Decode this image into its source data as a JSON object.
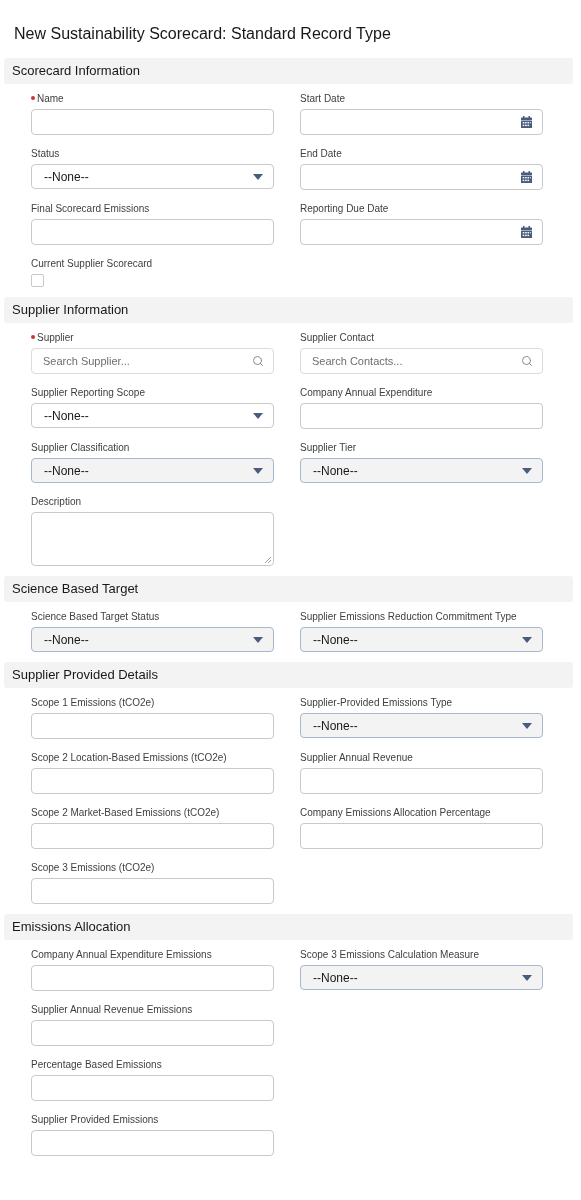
{
  "title": "New Sustainability Scorecard: Standard Record Type",
  "sections": [
    {
      "title": "Scorecard Information",
      "rows": [
        {
          "left": {
            "kind": "text",
            "label": "Name",
            "required": true
          },
          "right": {
            "kind": "date",
            "label": "Start Date",
            "required": false
          }
        },
        {
          "left": {
            "kind": "select",
            "label": "Status",
            "required": false,
            "value": "--None--",
            "shaded": false
          },
          "right": {
            "kind": "date",
            "label": "End Date",
            "required": false
          }
        },
        {
          "left": {
            "kind": "text",
            "label": "Final Scorecard Emissions",
            "required": false
          },
          "right": {
            "kind": "date",
            "label": "Reporting Due Date",
            "required": false
          }
        },
        {
          "left": {
            "kind": "checkbox",
            "label": "Current Supplier Scorecard",
            "required": false,
            "checked": false
          }
        }
      ]
    },
    {
      "title": "Supplier Information",
      "rows": [
        {
          "left": {
            "kind": "lookup",
            "label": "Supplier",
            "required": true,
            "placeholder": "Search Supplier..."
          },
          "right": {
            "kind": "lookup",
            "label": "Supplier Contact",
            "required": false,
            "placeholder": "Search Contacts..."
          }
        },
        {
          "left": {
            "kind": "select",
            "label": "Supplier Reporting Scope",
            "required": false,
            "value": "--None--",
            "shaded": false
          },
          "right": {
            "kind": "text",
            "label": "Company Annual Expenditure",
            "required": false
          }
        },
        {
          "left": {
            "kind": "select",
            "label": "Supplier Classification",
            "required": false,
            "value": "--None--",
            "shaded": true
          },
          "right": {
            "kind": "select",
            "label": "Supplier Tier",
            "required": false,
            "value": "--None--",
            "shaded": true
          }
        },
        {
          "left": {
            "kind": "textarea",
            "label": "Description",
            "required": false
          }
        }
      ]
    },
    {
      "title": "Science Based Target",
      "rows": [
        {
          "left": {
            "kind": "select",
            "label": "Science Based Target Status",
            "required": false,
            "value": "--None--",
            "shaded": true
          },
          "right": {
            "kind": "select",
            "label": "Supplier Emissions Reduction Commitment Type",
            "required": false,
            "value": "--None--",
            "shaded": true
          }
        }
      ]
    },
    {
      "title": "Supplier Provided Details",
      "rows": [
        {
          "left": {
            "kind": "text",
            "label": "Scope 1 Emissions (tCO2e)",
            "required": false
          },
          "right": {
            "kind": "select",
            "label": "Supplier-Provided Emissions Type",
            "required": false,
            "value": "--None--",
            "shaded": true
          }
        },
        {
          "left": {
            "kind": "text",
            "label": "Scope 2 Location-Based Emissions (tCO2e)",
            "required": false
          },
          "right": {
            "kind": "text",
            "label": "Supplier Annual Revenue",
            "required": false
          }
        },
        {
          "left": {
            "kind": "text",
            "label": "Scope 2 Market-Based Emissions (tCO2e)",
            "required": false
          },
          "right": {
            "kind": "text",
            "label": "Company Emissions Allocation Percentage",
            "required": false
          }
        },
        {
          "left": {
            "kind": "text",
            "label": "Scope 3 Emissions (tCO2e)",
            "required": false
          }
        }
      ]
    },
    {
      "title": "Emissions Allocation",
      "rows": [
        {
          "left": {
            "kind": "text",
            "label": "Company Annual Expenditure Emissions",
            "required": false
          },
          "right": {
            "kind": "select",
            "label": "Scope 3 Emissions Calculation Measure",
            "required": false,
            "value": "--None--",
            "shaded": true
          }
        },
        {
          "left": {
            "kind": "text",
            "label": "Supplier Annual Revenue Emissions",
            "required": false
          }
        },
        {
          "left": {
            "kind": "text",
            "label": "Percentage Based Emissions",
            "required": false
          }
        },
        {
          "left": {
            "kind": "text",
            "label": "Supplier Provided Emissions",
            "required": false
          }
        }
      ]
    }
  ]
}
